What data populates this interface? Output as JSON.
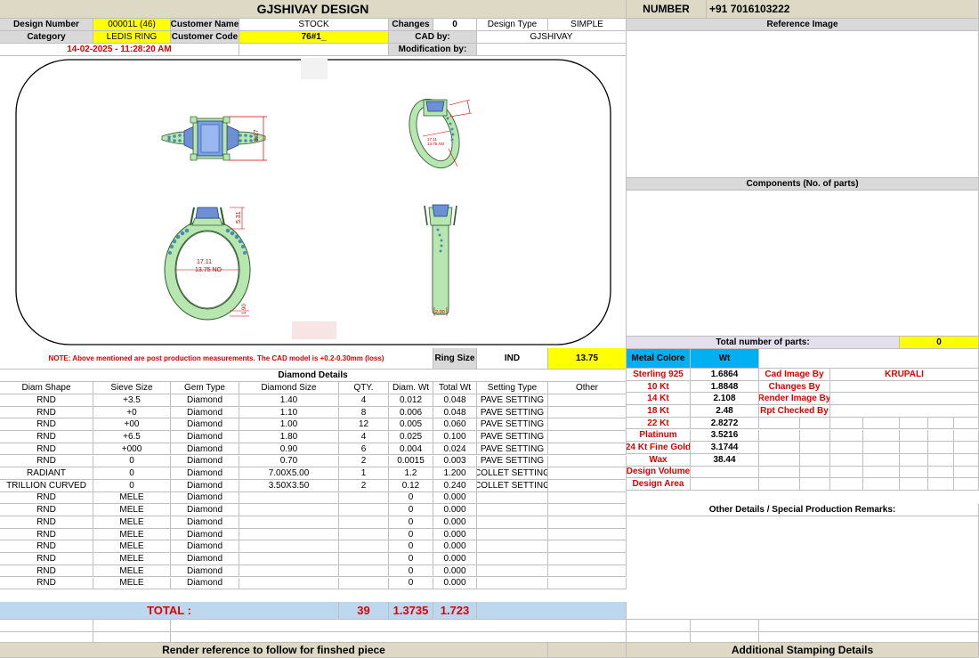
{
  "header": {
    "title": "GJSHIVAY DESIGN",
    "number_label": "NUMBER",
    "number_value": "+91 7016103222"
  },
  "info": {
    "design_number_label": "Design Number",
    "design_number": "00001L (46)",
    "customer_name_label": "Customer Name",
    "customer_name": "STOCK",
    "changes_label": "Changes",
    "changes": "0",
    "design_type_label": "Design Type",
    "design_type": "SIMPLE",
    "category_label": "Category",
    "category": "LEDIS RING",
    "customer_code_label": "Customer Code",
    "customer_code": "76#1_",
    "cad_by_label": "CAD by:",
    "cad_by": "GJSHIVAY",
    "datetime": "14-02-2025 - 11:28:20 AM",
    "modification_label": "Modification by:"
  },
  "drawing": {
    "dim_height": "9.17",
    "dim_side": "5.31",
    "dim_size": "17.11",
    "dim_no": "13.75 NO",
    "dim_bottom": "1.90",
    "dim_shank": "2.00",
    "dim_persp_size": "17.11",
    "dim_persp_no": "13.75 NO"
  },
  "right": {
    "reference_image": "Reference Image",
    "components": "Components (No. of parts)",
    "total_parts_label": "Total number of parts:",
    "total_parts": "0",
    "other_details": "Other Details / Special Production Remarks:",
    "additional_stamping": "Additional Stamping Details"
  },
  "note": "NOTE: Above mentioned are post production measurements. The CAD model is +0.2-0.30mm (loss)",
  "ring_size_label": "Ring Size",
  "ring_size_country": "IND",
  "ring_size": "13.75",
  "metal": {
    "header_label": "Metal Colore",
    "header_wt": "Wt",
    "rows": [
      {
        "name": "Sterling 925",
        "wt": "1.6864"
      },
      {
        "name": "10 Kt",
        "wt": "1.8848"
      },
      {
        "name": "14 Kt",
        "wt": "2.108"
      },
      {
        "name": "18 Kt",
        "wt": "2.48"
      },
      {
        "name": "22 Kt",
        "wt": "2.8272"
      },
      {
        "name": "Platinum",
        "wt": "3.5216"
      },
      {
        "name": "24 Kt Fine Gold",
        "wt": "3.1744"
      },
      {
        "name": "Wax",
        "wt": "38.44"
      },
      {
        "name": "Design Volume",
        "wt": ""
      },
      {
        "name": "Design Area",
        "wt": ""
      }
    ]
  },
  "credits": {
    "rows": [
      {
        "label": "Cad Image By",
        "value": "KRUPALI"
      },
      {
        "label": "Changes By",
        "value": ""
      },
      {
        "label": "Render Image By",
        "value": ""
      },
      {
        "label": "Rpt Checked By",
        "value": ""
      }
    ]
  },
  "diamond": {
    "title": "Diamond Details",
    "headers": [
      "Diam Shape",
      "Sieve Size",
      "Gem Type",
      "Diamond Size",
      "QTY.",
      "Diam. Wt",
      "Total Wt",
      "Setting Type",
      "Other"
    ],
    "rows": [
      [
        "RND",
        "+3.5",
        "Diamond",
        "1.40",
        "4",
        "0.012",
        "0.048",
        "PAVE SETTING",
        ""
      ],
      [
        "RND",
        "+0",
        "Diamond",
        "1.10",
        "8",
        "0.006",
        "0.048",
        "PAVE SETTING",
        ""
      ],
      [
        "RND",
        "+00",
        "Diamond",
        "1.00",
        "12",
        "0.005",
        "0.060",
        "PAVE SETTING",
        ""
      ],
      [
        "RND",
        "+6.5",
        "Diamond",
        "1.80",
        "4",
        "0.025",
        "0.100",
        "PAVE SETTING",
        ""
      ],
      [
        "RND",
        "+000",
        "Diamond",
        "0.90",
        "6",
        "0.004",
        "0.024",
        "PAVE SETTING",
        ""
      ],
      [
        "RND",
        "0",
        "Diamond",
        "0.70",
        "2",
        "0.0015",
        "0.003",
        "PAVE SETTING",
        ""
      ],
      [
        "RADIANT",
        "0",
        "Diamond",
        "7.00X5.00",
        "1",
        "1.2",
        "1.200",
        "COLLET SETTING",
        ""
      ],
      [
        "TRILLION CURVED",
        "0",
        "Diamond",
        "3.50X3.50",
        "2",
        "0.12",
        "0.240",
        "COLLET SETTING",
        ""
      ],
      [
        "RND",
        "MELE",
        "Diamond",
        "",
        "",
        "0",
        "0.000",
        "",
        ""
      ],
      [
        "RND",
        "MELE",
        "Diamond",
        "",
        "",
        "0",
        "0.000",
        "",
        ""
      ],
      [
        "RND",
        "MELE",
        "Diamond",
        "",
        "",
        "0",
        "0.000",
        "",
        ""
      ],
      [
        "RND",
        "MELE",
        "Diamond",
        "",
        "",
        "0",
        "0.000",
        "",
        ""
      ],
      [
        "RND",
        "MELE",
        "Diamond",
        "",
        "",
        "0",
        "0.000",
        "",
        ""
      ],
      [
        "RND",
        "MELE",
        "Diamond",
        "",
        "",
        "0",
        "0.000",
        "",
        ""
      ],
      [
        "RND",
        "MELE",
        "Diamond",
        "",
        "",
        "0",
        "0.000",
        "",
        ""
      ],
      [
        "RND",
        "MELE",
        "Diamond",
        "",
        "",
        "0",
        "0.000",
        "",
        ""
      ]
    ],
    "total_label": "TOTAL :",
    "total_qty": "39",
    "total_diam_wt": "1.3735",
    "total_wt": "1.723"
  },
  "footer": {
    "render_reference": "Render reference to follow for finshed piece"
  },
  "colors": {
    "yellow": "#ffff00",
    "blue": "#00b0f0",
    "light_blue": "#bdd7ee",
    "red": "#e00000",
    "ring_green": "#b8e6b0",
    "gem_blue": "#6d8fd6"
  }
}
